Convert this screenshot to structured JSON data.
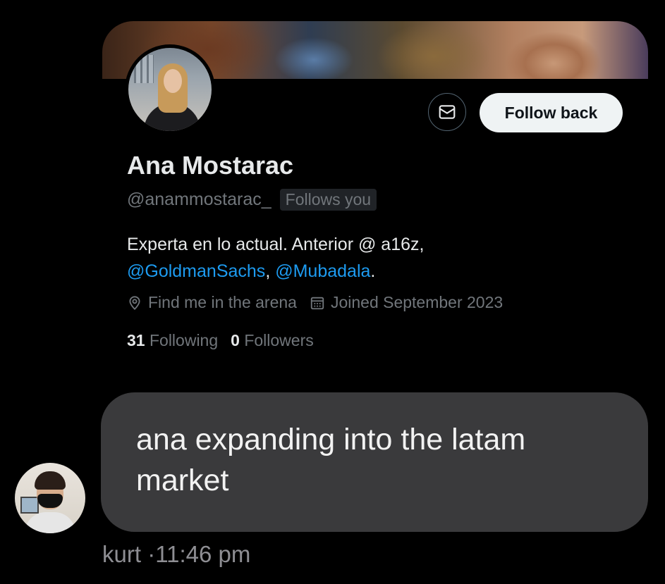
{
  "profile": {
    "name": "Ana Mostarac",
    "handle": "@anammostarac_",
    "follows_badge": "Follows you",
    "bio_text": "Experta en lo actual. Anterior @ a16z,",
    "bio_mention_1": "@GoldmanSachs",
    "bio_sep": ", ",
    "bio_mention_2": "@Mubadala",
    "bio_end": ".",
    "location": "Find me in the arena",
    "joined": "Joined September 2023",
    "following_count": "31",
    "following_label": "Following",
    "followers_count": "0",
    "followers_label": "Followers",
    "follow_button": "Follow back",
    "icons": [
      "message-icon",
      "location-pin-icon",
      "calendar-icon"
    ]
  },
  "message": {
    "text": "ana expanding into the latam market",
    "sender": "kurt",
    "separator": "·",
    "time": "11:46 pm"
  },
  "colors": {
    "background": "#000000",
    "bubble": "#3a3a3c",
    "mention": "#1d9bf0",
    "muted": "#71767b",
    "button_bg": "#eff3f4"
  }
}
